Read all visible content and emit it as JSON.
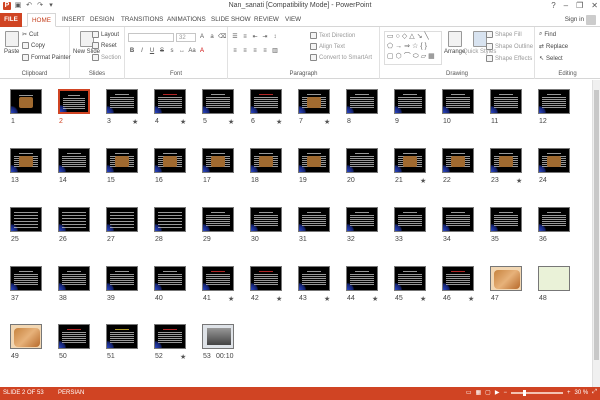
{
  "window": {
    "title": "Nan_sanati [Compatibility Mode] - PowerPoint",
    "app_icon": "P",
    "controls": [
      "?",
      "–",
      "❐",
      "✕"
    ]
  },
  "quick_access": [
    "save-icon",
    "undo-icon",
    "redo-icon",
    "customize-icon"
  ],
  "tabs": [
    "FILE",
    "HOME",
    "INSERT",
    "DESIGN",
    "TRANSITIONS",
    "ANIMATIONS",
    "SLIDE SHOW",
    "REVIEW",
    "VIEW"
  ],
  "active_tab": "HOME",
  "sign_in": "Sign in",
  "ribbon": {
    "clipboard": {
      "label": "Clipboard",
      "paste": "Paste",
      "cut": "Cut",
      "copy": "Copy",
      "format_painter": "Format Painter"
    },
    "slides": {
      "label": "Slides",
      "new_slide": "New Slide",
      "layout": "Layout",
      "reset": "Reset",
      "section": "Section"
    },
    "font": {
      "label": "Font",
      "size": "32"
    },
    "paragraph": {
      "label": "Paragraph",
      "text_direction": "Text Direction",
      "align_text": "Align Text",
      "convert_smartart": "Convert to SmartArt"
    },
    "drawing": {
      "label": "Drawing",
      "arrange": "Arrange",
      "quick_styles": "Quick Styles",
      "shape_fill": "Shape Fill",
      "shape_outline": "Shape Outline",
      "shape_effects": "Shape Effects"
    },
    "editing": {
      "label": "Editing",
      "find": "Find",
      "replace": "Replace",
      "select": "Select"
    }
  },
  "slides": [
    {
      "n": "1",
      "style": "title",
      "star": false
    },
    {
      "n": "2",
      "style": "text",
      "star": false,
      "selected": true
    },
    {
      "n": "3",
      "style": "text",
      "star": true
    },
    {
      "n": "4",
      "style": "red",
      "star": true
    },
    {
      "n": "5",
      "style": "text",
      "star": true
    },
    {
      "n": "6",
      "style": "red",
      "star": true
    },
    {
      "n": "7",
      "style": "pic",
      "star": true
    },
    {
      "n": "8",
      "style": "text",
      "star": false
    },
    {
      "n": "9",
      "style": "text",
      "star": false
    },
    {
      "n": "10",
      "style": "text",
      "star": false
    },
    {
      "n": "11",
      "style": "text",
      "star": false
    },
    {
      "n": "12",
      "style": "text",
      "star": false
    },
    {
      "n": "13",
      "style": "pic",
      "star": false
    },
    {
      "n": "14",
      "style": "text",
      "star": false
    },
    {
      "n": "15",
      "style": "pic",
      "star": false
    },
    {
      "n": "16",
      "style": "pic",
      "star": false
    },
    {
      "n": "17",
      "style": "pic",
      "star": false
    },
    {
      "n": "18",
      "style": "pic",
      "star": false
    },
    {
      "n": "19",
      "style": "pic",
      "star": false
    },
    {
      "n": "20",
      "style": "text",
      "star": false
    },
    {
      "n": "21",
      "style": "pic",
      "star": true
    },
    {
      "n": "22",
      "style": "pic",
      "star": false
    },
    {
      "n": "23",
      "style": "pic",
      "star": true
    },
    {
      "n": "24",
      "style": "pic",
      "star": false
    },
    {
      "n": "25",
      "style": "table",
      "star": false
    },
    {
      "n": "26",
      "style": "table",
      "star": false
    },
    {
      "n": "27",
      "style": "table",
      "star": false
    },
    {
      "n": "28",
      "style": "table",
      "star": false
    },
    {
      "n": "29",
      "style": "text",
      "star": false
    },
    {
      "n": "30",
      "style": "text",
      "star": false
    },
    {
      "n": "31",
      "style": "text",
      "star": false
    },
    {
      "n": "32",
      "style": "text",
      "star": false
    },
    {
      "n": "33",
      "style": "text",
      "star": false
    },
    {
      "n": "34",
      "style": "text",
      "star": false
    },
    {
      "n": "35",
      "style": "text",
      "star": false
    },
    {
      "n": "36",
      "style": "text",
      "star": false
    },
    {
      "n": "37",
      "style": "text",
      "star": false
    },
    {
      "n": "38",
      "style": "text",
      "star": false
    },
    {
      "n": "39",
      "style": "text",
      "star": false
    },
    {
      "n": "40",
      "style": "text",
      "star": false
    },
    {
      "n": "41",
      "style": "red",
      "star": true
    },
    {
      "n": "42",
      "style": "red",
      "star": true
    },
    {
      "n": "43",
      "style": "text",
      "star": true
    },
    {
      "n": "44",
      "style": "text",
      "star": true
    },
    {
      "n": "45",
      "style": "text",
      "star": true
    },
    {
      "n": "46",
      "style": "red",
      "star": true
    },
    {
      "n": "47",
      "style": "photo",
      "star": false
    },
    {
      "n": "48",
      "style": "photo2",
      "star": false
    },
    {
      "n": "49",
      "style": "photo",
      "star": false
    },
    {
      "n": "50",
      "style": "red",
      "star": false
    },
    {
      "n": "51",
      "style": "blue",
      "star": false
    },
    {
      "n": "52",
      "style": "red",
      "star": true
    },
    {
      "n": "53",
      "style": "video",
      "star": false,
      "extra": "00:10"
    }
  ],
  "status": {
    "slide_info": "SLIDE 2 OF 53",
    "language": "PERSIAN",
    "zoom": "30 %"
  },
  "colors": {
    "accent": "#d04423",
    "slide_bg": "#000000"
  }
}
